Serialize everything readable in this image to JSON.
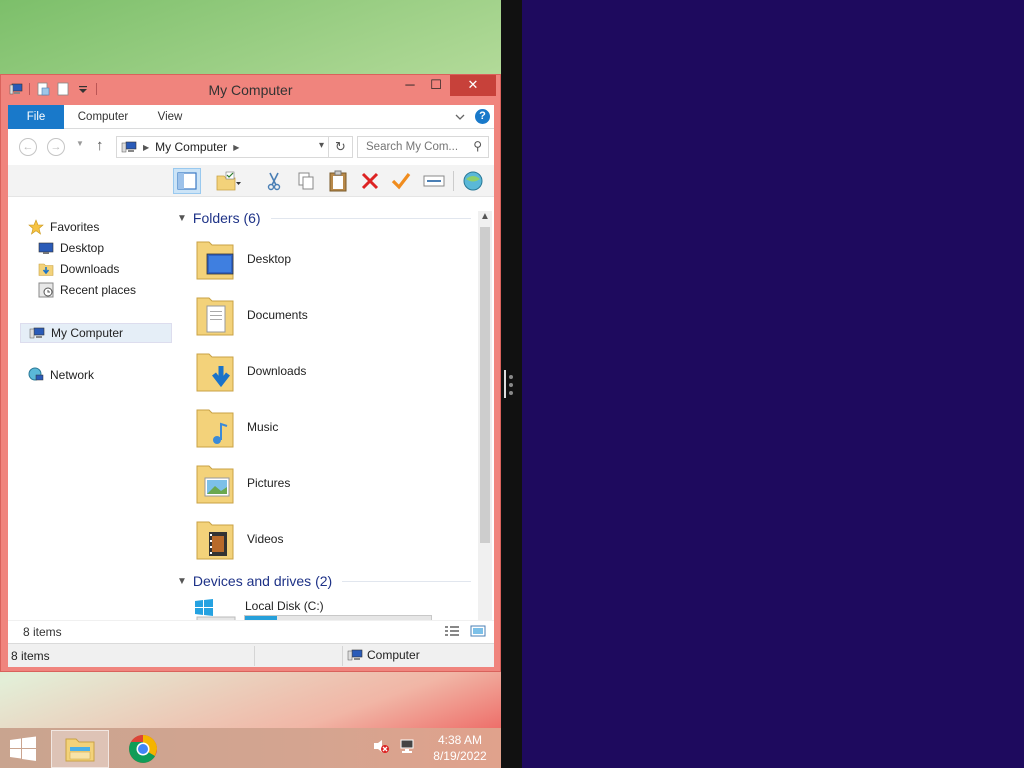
{
  "window": {
    "title": "My Computer",
    "controls": {
      "minimize": "─",
      "maximize": "☐",
      "close": "✕"
    }
  },
  "ribbon": {
    "tabs": {
      "file": "File",
      "computer": "Computer",
      "view": "View"
    },
    "help": "?"
  },
  "nav": {
    "back": "←",
    "forward": "→",
    "up": "↑",
    "address": "My Computer",
    "search_placeholder": "Search My Com..."
  },
  "sidebar": {
    "favorites": "Favorites",
    "desktop": "Desktop",
    "downloads": "Downloads",
    "recent_places": "Recent places",
    "my_computer": "My Computer",
    "network": "Network"
  },
  "content": {
    "folders_header": "Folders (6)",
    "folders": [
      "Desktop",
      "Documents",
      "Downloads",
      "Music",
      "Pictures",
      "Videos"
    ],
    "drives_header": "Devices and drives (2)",
    "drive_c": {
      "name": "Local Disk (C:)",
      "used_fraction": 0.17
    }
  },
  "inner_status": {
    "items": "8 items"
  },
  "status_bar": {
    "items": "8 items",
    "zone": "Computer"
  },
  "taskbar": {
    "time": "4:38 AM",
    "date": "8/19/2022"
  },
  "colors": {
    "window_frame": "#f0847d",
    "accent": "#1979ca",
    "desktop_right": "#1e0a5e"
  }
}
